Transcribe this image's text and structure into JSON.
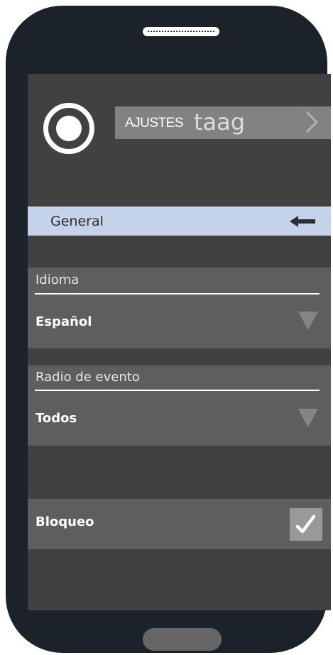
{
  "header": {
    "title_prefix": "AJUSTES",
    "brand": "taag"
  },
  "section": {
    "label": "General"
  },
  "language": {
    "label": "Idioma",
    "value": "Español"
  },
  "event_radius": {
    "label": "Radio de evento",
    "value": "Todos"
  },
  "lock": {
    "label": "Bloqueo",
    "checked": true
  },
  "colors": {
    "phone_body": "#1b2229",
    "screen_bg": "#414141",
    "section_highlight": "#c4d3ea",
    "panel_bg": "#5e5e5e",
    "title_bar_bg": "#828282"
  }
}
